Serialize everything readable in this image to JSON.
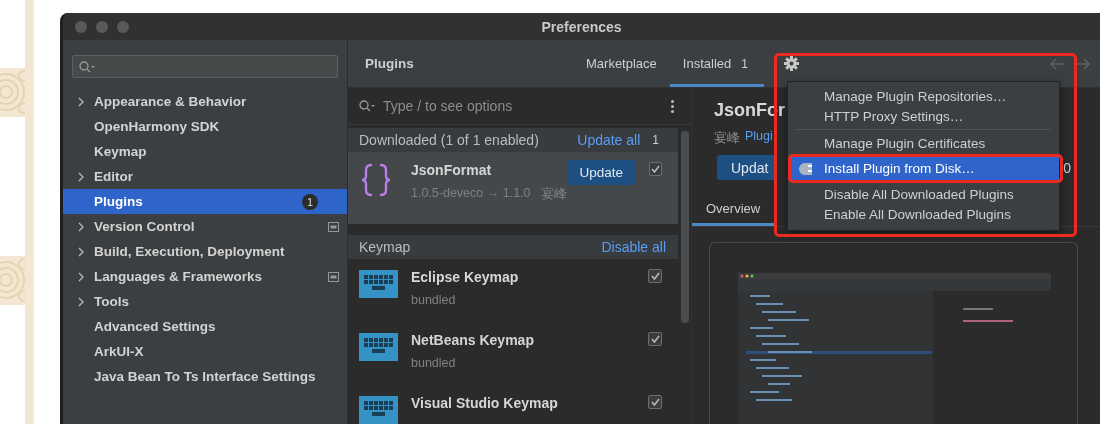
{
  "window": {
    "title": "Preferences"
  },
  "sidebar": {
    "items": [
      {
        "label": "Appearance & Behavior",
        "expandable": true,
        "selected": false,
        "project_level": false
      },
      {
        "label": "OpenHarmony SDK",
        "expandable": false,
        "selected": false,
        "project_level": false
      },
      {
        "label": "Keymap",
        "expandable": false,
        "selected": false,
        "project_level": false
      },
      {
        "label": "Editor",
        "expandable": true,
        "selected": false,
        "project_level": false
      },
      {
        "label": "Plugins",
        "expandable": false,
        "selected": true,
        "project_level": false,
        "badge": "1"
      },
      {
        "label": "Version Control",
        "expandable": true,
        "selected": false,
        "project_level": true
      },
      {
        "label": "Build, Execution, Deployment",
        "expandable": true,
        "selected": false,
        "project_level": false
      },
      {
        "label": "Languages & Frameworks",
        "expandable": true,
        "selected": false,
        "project_level": true
      },
      {
        "label": "Tools",
        "expandable": true,
        "selected": false,
        "project_level": false
      },
      {
        "label": "Advanced Settings",
        "expandable": false,
        "selected": false,
        "project_level": false
      },
      {
        "label": "ArkUI-X",
        "expandable": false,
        "selected": false,
        "project_level": false
      },
      {
        "label": "Java Bean To Ts Interface Settings",
        "expandable": false,
        "selected": false,
        "project_level": false
      }
    ]
  },
  "plugins": {
    "title": "Plugins",
    "tabs": [
      {
        "label": "Marketplace",
        "selected": false
      },
      {
        "label": "Installed",
        "selected": true,
        "badge": "1"
      }
    ],
    "search": {
      "placeholder": "Type / to see options"
    },
    "sections": [
      {
        "title": "Downloaded (1 of 1 enabled)",
        "action": "Update all",
        "count": "1",
        "plugins": [
          {
            "kind": "json",
            "name": "JsonFormat",
            "details": [
              "1.0.5-deveco → 1.1.0",
              "宴峰"
            ],
            "button": "Update",
            "checked": true,
            "selected": true
          }
        ]
      },
      {
        "title": "Keymap",
        "action": "Disable all",
        "plugins": [
          {
            "kind": "keymap",
            "name": "Eclipse Keymap",
            "details": [
              "bundled"
            ],
            "checked": true,
            "selected": false
          },
          {
            "kind": "keymap",
            "name": "NetBeans Keymap",
            "details": [
              "bundled"
            ],
            "checked": true,
            "selected": false
          },
          {
            "kind": "keymap",
            "name": "Visual Studio Keymap",
            "checked": true,
            "selected": false
          }
        ]
      }
    ]
  },
  "details": {
    "title": "JsonFor",
    "vendor": "宴峰",
    "link": "Plugi",
    "button": "Updat",
    "trailing": "0",
    "tabs": [
      {
        "label": "Overview",
        "selected": true
      }
    ]
  },
  "menu": {
    "items": [
      {
        "kind": "item",
        "label": "Manage Plugin Repositories…",
        "selected": false
      },
      {
        "kind": "item",
        "label": "HTTP Proxy Settings…",
        "selected": false
      },
      {
        "kind": "separator"
      },
      {
        "kind": "item",
        "label": "Manage Plugin Certificates",
        "selected": false
      },
      {
        "kind": "icon_item",
        "label": "Install Plugin from Disk…",
        "selected": true
      },
      {
        "kind": "item",
        "label": "Disable All Downloaded Plugins",
        "selected": false
      },
      {
        "kind": "item",
        "label": "Enable All Downloaded Plugins",
        "selected": false
      }
    ]
  }
}
